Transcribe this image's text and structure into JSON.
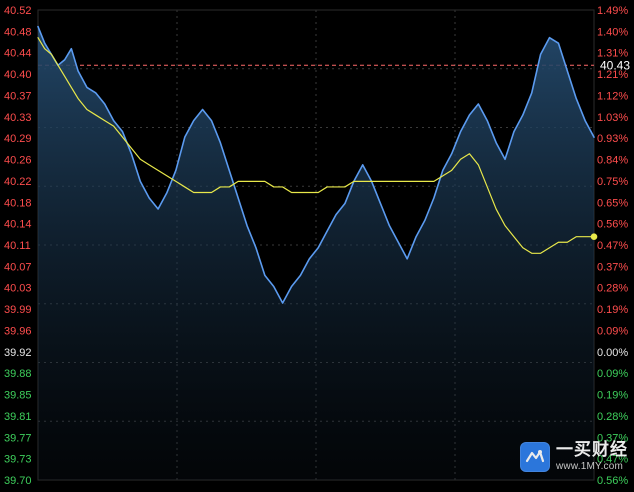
{
  "chart_data": {
    "type": "line",
    "title": "",
    "xlabel": "",
    "ylabel": "",
    "ylim": [
      39.68,
      40.53
    ],
    "grid": true,
    "reference_price": 39.92,
    "last_price_label": "40.43",
    "colors": {
      "background": "#000000",
      "price_line": "#5b9bf0",
      "price_fill_top": "#1f3b57",
      "avg_line": "#e8e84a",
      "grid": "#3a3a3a",
      "up_text": "#ff4d4d",
      "down_text": "#3ecf5c",
      "neutral_text": "#e6e6e6",
      "ref_line": "#ff6b6b",
      "last_price_text": "#ffffff"
    },
    "y_tick_labels_left": [
      "40.52",
      "40.48",
      "40.44",
      "40.40",
      "40.37",
      "40.33",
      "40.29",
      "40.26",
      "40.22",
      "40.18",
      "40.14",
      "40.11",
      "40.07",
      "40.03",
      "39.99",
      "39.96",
      "39.92",
      "39.88",
      "39.85",
      "39.81",
      "39.77",
      "39.73",
      "39.70"
    ],
    "y_tick_labels_right": [
      "1.49%",
      "1.40%",
      "1.31%",
      "1.21%",
      "1.12%",
      "1.03%",
      "0.93%",
      "0.84%",
      "0.75%",
      "0.65%",
      "0.56%",
      "0.47%",
      "0.37%",
      "0.28%",
      "0.19%",
      "0.09%",
      "0.00%",
      "0.09%",
      "0.19%",
      "0.28%",
      "0.37%",
      "0.47%",
      "0.56%"
    ],
    "x": [
      0,
      3,
      6,
      9,
      12,
      15,
      18,
      22,
      26,
      30,
      34,
      38,
      42,
      46,
      50,
      54,
      58,
      62,
      66,
      70,
      74,
      78,
      82,
      86,
      90,
      94,
      98,
      102,
      106,
      110,
      114,
      118,
      122,
      126,
      130,
      134,
      138,
      142,
      146,
      150,
      154,
      158,
      162,
      166,
      170,
      174,
      178,
      182,
      186,
      190,
      194,
      198,
      202,
      206,
      210,
      214,
      218,
      222,
      226,
      230,
      234,
      238,
      242,
      246,
      250
    ],
    "series": [
      {
        "values": [
          40.5,
          40.47,
          40.45,
          40.43,
          40.44,
          40.46,
          40.42,
          40.39,
          40.38,
          40.36,
          40.33,
          40.31,
          40.27,
          40.22,
          40.19,
          40.17,
          40.2,
          40.24,
          40.3,
          40.33,
          40.35,
          40.33,
          40.29,
          40.24,
          40.19,
          40.14,
          40.1,
          40.05,
          40.03,
          40.0,
          40.03,
          40.05,
          40.08,
          40.1,
          40.13,
          40.16,
          40.18,
          40.22,
          40.25,
          40.22,
          40.18,
          40.14,
          40.11,
          40.08,
          40.12,
          40.15,
          40.19,
          40.24,
          40.27,
          40.31,
          40.34,
          40.36,
          40.33,
          40.29,
          40.26,
          40.31,
          40.34,
          40.38,
          40.45,
          40.48,
          40.47,
          40.42,
          40.37,
          40.33,
          40.3
        ]
      },
      {
        "values": [
          40.48,
          40.46,
          40.45,
          40.43,
          40.41,
          40.39,
          40.37,
          40.35,
          40.34,
          40.33,
          40.32,
          40.3,
          40.28,
          40.26,
          40.25,
          40.24,
          40.23,
          40.22,
          40.21,
          40.2,
          40.2,
          40.2,
          40.21,
          40.21,
          40.22,
          40.22,
          40.22,
          40.22,
          40.21,
          40.21,
          40.2,
          40.2,
          40.2,
          40.2,
          40.21,
          40.21,
          40.21,
          40.22,
          40.22,
          40.22,
          40.22,
          40.22,
          40.22,
          40.22,
          40.22,
          40.22,
          40.22,
          40.23,
          40.24,
          40.26,
          40.27,
          40.25,
          40.21,
          40.17,
          40.14,
          40.12,
          40.1,
          40.09,
          40.09,
          40.1,
          40.11,
          40.11,
          40.12,
          40.12,
          40.12
        ]
      }
    ]
  },
  "watermark": {
    "brand": "一买财经",
    "url": "www.1MY.com",
    "logo_text": "1MY"
  }
}
